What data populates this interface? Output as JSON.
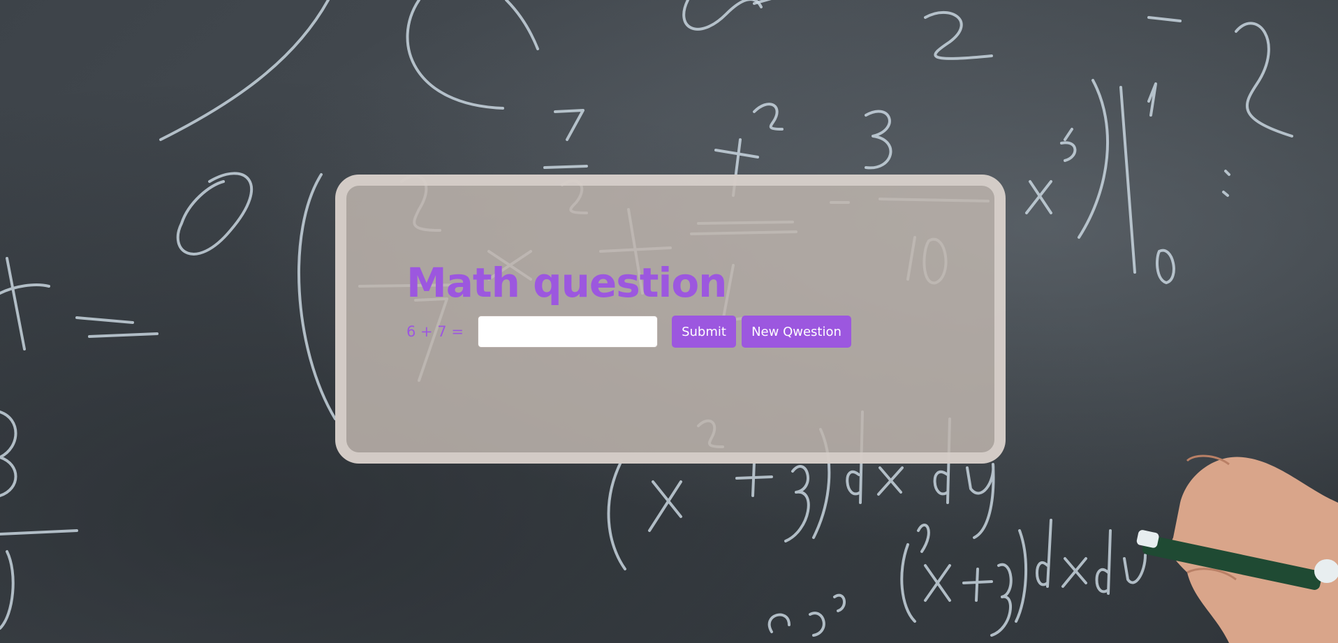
{
  "page": {
    "title": "Math question"
  },
  "quiz": {
    "question": "6 + 7 =",
    "answer_value": "",
    "answer_placeholder": "",
    "submit_label": "Submit",
    "new_question_label": "New Qwestion"
  },
  "colors": {
    "accent": "#9c57df",
    "card_border": "#d6cdc8",
    "card_fill": "#beb4ae",
    "board": "#3d4349"
  },
  "background": {
    "icon": "chalkboard-with-handwritten-equations"
  }
}
